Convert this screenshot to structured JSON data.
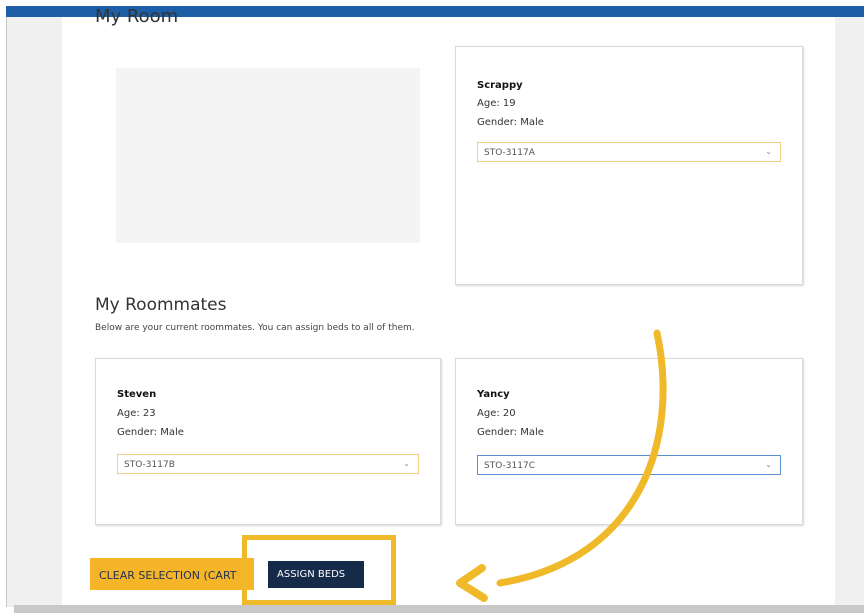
{
  "my_room": {
    "title": "My Room",
    "resident": {
      "name": "Scrappy",
      "age": "Age: 19",
      "gender": "Gender: Male",
      "bed": "STO-3117A"
    }
  },
  "roommates_section": {
    "title": "My Roommates",
    "description": "Below are your current roommates. You can assign beds to all of them.",
    "roommates": [
      {
        "name": "Steven",
        "age": "Age: 23",
        "gender": "Gender: Male",
        "bed": "STO-3117B"
      },
      {
        "name": "Yancy",
        "age": "Age: 20",
        "gender": "Gender: Male",
        "bed": "STO-3117C"
      }
    ]
  },
  "actions": {
    "clear_label": "CLEAR SELECTION (CART",
    "assign_label": "ASSIGN BEDS"
  },
  "icons": {
    "select_chevron": "chevron-down-icon",
    "annotation": "curved-arrow-icon"
  },
  "colors": {
    "topbar": "#1c5fa6",
    "clear_button": "#f6b429",
    "assign_button": "#162a4a",
    "highlight": "#f0b92a"
  }
}
